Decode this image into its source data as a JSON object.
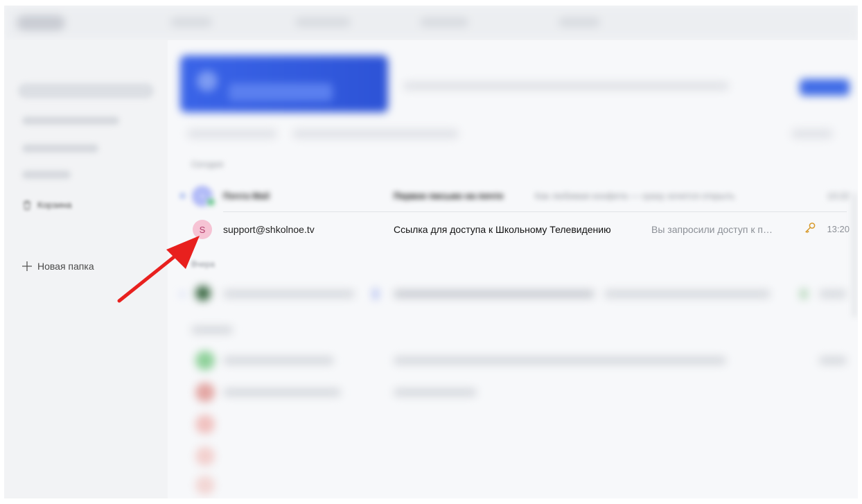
{
  "sidebar": {
    "trash_label": "Корзина",
    "new_folder_label": "Новая папка"
  },
  "emails": {
    "group_today": "Сегодня",
    "group_yesterday": "Вчера",
    "row1": {
      "sender": "Почта Mail",
      "subject": "Первое письмо на почте",
      "preview": "Как любимая конфета — сразу хочется открыть",
      "time": "13:22"
    },
    "row2": {
      "avatar_letter": "S",
      "sender": "support@shkolnoe.tv",
      "subject": "Ссылка для доступа к Школьному Телевидению",
      "preview": "Вы запросили доступ к п…",
      "time": "13:20"
    }
  },
  "colors": {
    "accent": "#3f6be6",
    "arrow": "#e8201e",
    "avatar_s_bg": "#f6c3d4",
    "key_icon": "#d79a2b"
  },
  "icons": {
    "trash": "trash-icon",
    "plus": "plus-icon",
    "key": "key-icon",
    "arrow": "red-arrow-annotation"
  }
}
